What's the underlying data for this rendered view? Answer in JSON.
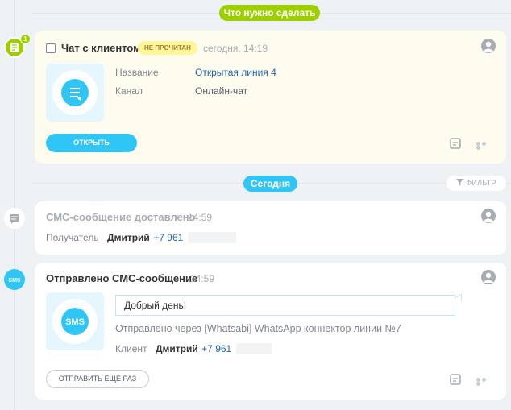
{
  "todo_label": "Что нужно сделать",
  "today_label": "Сегодня",
  "filter_label": "ФИЛЬТР",
  "colors": {
    "green": "#9dcf00",
    "blue": "#2fc6f6",
    "task_bg": "#fefcee",
    "unread_bg": "#fff599"
  },
  "task": {
    "badge_count": "1",
    "title": "Чат с клиентом",
    "status": "НЕ ПРОЧИТАН",
    "time": "сегодня, 14:19",
    "name_label": "Название",
    "name_value": "Открытая линия 4",
    "channel_label": "Канал",
    "channel_value": "Онлайн-чат",
    "open_button": "ОТКРЫТЬ",
    "icons": [
      "chat-icon",
      "note-icon",
      "more-icon",
      "avatar-icon"
    ]
  },
  "sms_delivered": {
    "title": "СМС-сообщение доставлено",
    "time": "14:59",
    "recipient_label": "Получатель",
    "recipient_name": "Дмитрий",
    "recipient_phone": "+7 961"
  },
  "sms_sent": {
    "title": "Отправлено СМС-сообщение",
    "time": "14:59",
    "message": "Добрый день!",
    "via": "Отправлено через [Whatsabi] WhatsApp коннектор линии №7",
    "client_label": "Клиент",
    "client_name": "Дмитрий",
    "client_phone": "+7 961",
    "sms_icon_text": "SMS",
    "resend_button": "ОТПРАВИТЬ ЕЩЁ РАЗ"
  }
}
